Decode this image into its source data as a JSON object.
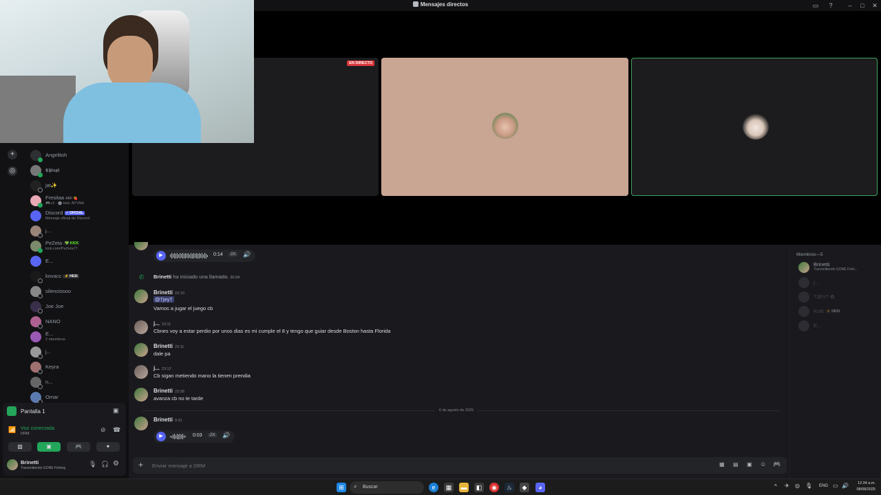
{
  "window": {
    "title": "Mensajes directos"
  },
  "dm_list": [
    {
      "name": "Angelitoh",
      "sub": "",
      "status": "online"
    },
    {
      "name": "𝕮𝖍𝖎𝖘𝖕𝖎",
      "sub": "",
      "status": "online"
    },
    {
      "name": "jat✨",
      "sub": "",
      "status": "offline"
    },
    {
      "name": "Fresitaa",
      "tag": "ARF 🍓",
      "sub": "🎮+2 · ⬤ kick: AYVNA",
      "status": "online"
    },
    {
      "name": "Discord",
      "badge": "✓ OFICIAL",
      "sub": "Mensaje oficial de Discord",
      "status": "none"
    },
    {
      "name": "j...",
      "sub": "",
      "status": "offline"
    },
    {
      "name": "PeZeta",
      "badge": "💚 KICK",
      "sub": "kick.com/PeZeta77",
      "status": "online"
    },
    {
      "name": "E...",
      "sub": "",
      "status": "offline"
    },
    {
      "name": "kovacc",
      "badge": "⚡ HESI",
      "sub": "",
      "status": "offline"
    },
    {
      "name": "silenciosoo",
      "sub": "",
      "status": "offline"
    },
    {
      "name": "Joe Joe",
      "sub": "",
      "status": "offline"
    },
    {
      "name": "NANO",
      "sub": "",
      "status": "offline"
    },
    {
      "name": "E...",
      "sub": "2 miembros",
      "status": "none"
    },
    {
      "name": "j...",
      "sub": "",
      "status": "offline"
    },
    {
      "name": "Keyra",
      "sub": "",
      "status": "offline"
    },
    {
      "name": "n...",
      "sub": "",
      "status": "offline"
    },
    {
      "name": "Omar",
      "sub": "",
      "status": "offline"
    }
  ],
  "voice_panel": {
    "screen_label": "Pantalla 1",
    "connection_status": "Voz conectada",
    "channel": "DRM"
  },
  "user_panel": {
    "username": "Brinetti",
    "activity": "Transmitiendo GONE Fishing"
  },
  "stage": {
    "live_badge": "EN DIRECTO"
  },
  "chat": {
    "top_voice": {
      "duration": "0:14",
      "speed": "2X"
    },
    "call_notice": {
      "author": "Brinetti",
      "text": "ha iniciado una llamada.",
      "time": "20:24"
    },
    "messages": [
      {
        "author": "Brinetti",
        "time": "23:10",
        "lines": [
          "@†jey†",
          "Vamos a jugar el juego cb"
        ]
      },
      {
        "author": "j...",
        "time": "23:11",
        "lines": [
          "Cbnes voy a estar perdio por unos dias es mi cumple el 8 y tengo que guiar desde Boston hasta Florida"
        ]
      },
      {
        "author": "Brinetti",
        "time": "23:11",
        "lines": [
          "dale pa"
        ]
      },
      {
        "author": "j...",
        "time": "23:12",
        "lines": [
          "Cb sigan metiendo mano la tienen prendia"
        ]
      },
      {
        "author": "Brinetti",
        "time": "23:38",
        "lines": [
          "avanza cb no te tarde"
        ]
      }
    ],
    "date_divider": "6 de agosto de 2025",
    "last_message": {
      "author": "Brinetti",
      "time": "0:31",
      "duration": "0:03",
      "speed": "2X"
    },
    "composer_placeholder": "Enviar mensaje a DRM"
  },
  "members": {
    "header": "Miembros—5",
    "list": [
      {
        "name": "Brinetti",
        "sub": "Transmitiendo GONE Fishi...",
        "dim": false
      },
      {
        "name": "j...",
        "sub": "",
        "dim": true
      },
      {
        "name": "†JEY† ✿",
        "sub": "",
        "dim": true
      },
      {
        "name": "KoN",
        "badge": "⚡ HESI",
        "sub": "",
        "dim": true
      },
      {
        "name": "E...",
        "sub": "",
        "dim": true
      }
    ]
  },
  "taskbar": {
    "search_label": "Buscar",
    "lang": "ENG",
    "time": "12:34 a.m.",
    "date": "08/08/2025"
  },
  "colors": {
    "accent": "#5865f2",
    "online": "#23a55a",
    "live": "#da373c",
    "tile_peach": "#c9a594",
    "speaking_border": "#3ba55c"
  }
}
